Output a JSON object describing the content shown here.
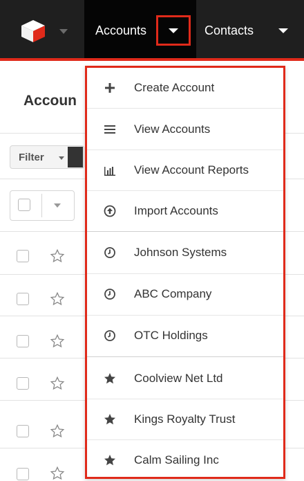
{
  "topnav": {
    "accounts_label": "Accounts",
    "contacts_label": "Contacts"
  },
  "list": {
    "title": "Accoun",
    "filter_label": "Filter"
  },
  "menu": {
    "actions": [
      {
        "label": "Create Account",
        "icon": "plus-icon"
      },
      {
        "label": "View Accounts",
        "icon": "list-icon"
      },
      {
        "label": "View Account Reports",
        "icon": "bar-chart-icon"
      },
      {
        "label": "Import Accounts",
        "icon": "upload-circle-icon"
      }
    ],
    "recently_viewed": [
      {
        "label": "Johnson Systems",
        "icon": "clock-icon"
      },
      {
        "label": "ABC Company",
        "icon": "clock-icon"
      },
      {
        "label": "OTC Holdings",
        "icon": "clock-icon"
      }
    ],
    "favorites": [
      {
        "label": "Coolview Net Ltd",
        "icon": "star-filled-icon"
      },
      {
        "label": "Kings Royalty Trust",
        "icon": "star-filled-icon"
      },
      {
        "label": "Calm Sailing Inc",
        "icon": "star-filled-icon"
      }
    ]
  },
  "colors": {
    "highlight": "#e02a1a",
    "topbar": "#1f1f1f"
  }
}
